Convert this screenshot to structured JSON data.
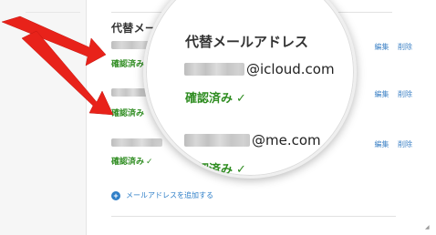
{
  "section": {
    "title": "代替メールアドレス"
  },
  "rows": [
    {
      "verified_label": "確認済み",
      "check": "✓",
      "edit_label": "編集",
      "delete_label": "削除"
    },
    {
      "verified_label": "確認済み",
      "check": "✓",
      "edit_label": "編集",
      "delete_label": "削除"
    },
    {
      "verified_label": "確認済み",
      "check": "✓",
      "edit_label": "編集",
      "delete_label": "削除"
    }
  ],
  "add_email": {
    "icon": "+",
    "label": "メールアドレスを追加する"
  },
  "magnifier": {
    "title": "代替メールアドレス",
    "emails": [
      {
        "domain": "@icloud.com",
        "verified_label": "確認済み",
        "check": "✓"
      },
      {
        "domain": "@me.com",
        "verified_label": "確認済み",
        "check": "✓"
      }
    ]
  },
  "colors": {
    "link": "#3f83c6",
    "verified": "#2e8c20",
    "arrow": "#e8221a"
  },
  "icons": {
    "arrow": "red-arrow-icon",
    "add": "plus-circle-icon"
  }
}
